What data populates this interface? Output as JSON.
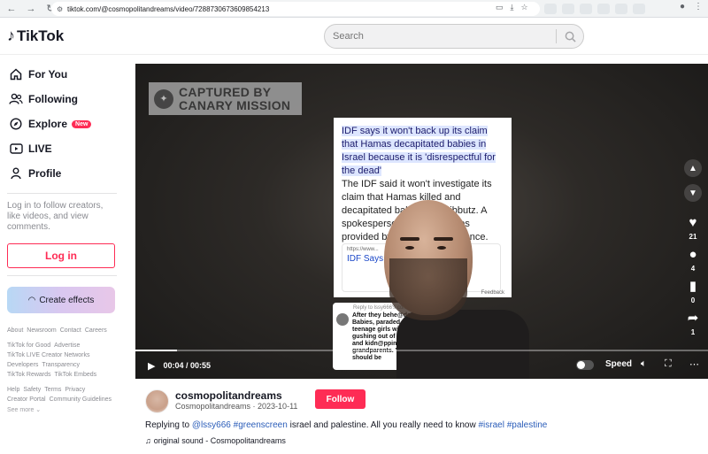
{
  "browser": {
    "url": "tiktok.com/@cosmopolitandreams/video/7288730673609854213"
  },
  "header": {
    "logo": "TikTok",
    "search_placeholder": "Search"
  },
  "sidebar": {
    "items": [
      {
        "label": "For You",
        "icon": "home-icon"
      },
      {
        "label": "Following",
        "icon": "people-icon"
      },
      {
        "label": "Explore",
        "icon": "compass-icon",
        "badge": "New"
      },
      {
        "label": "LIVE",
        "icon": "live-icon"
      },
      {
        "label": "Profile",
        "icon": "person-icon"
      }
    ],
    "login_hint": "Log in to follow creators, like videos, and view comments.",
    "login_label": "Log in",
    "effects_label": "Create effects",
    "links": {
      "row1": [
        "About",
        "Newsroom",
        "Contact",
        "Careers"
      ],
      "row2": [
        "TikTok for Good",
        "Advertise",
        "TikTok LIVE Creator Networks",
        "Developers",
        "Transparency",
        "TikTok Rewards",
        "TikTok Embeds"
      ],
      "row3": [
        "Help",
        "Safety",
        "Terms",
        "Privacy",
        "Creator Portal",
        "Community Guidelines"
      ],
      "see_more": "See more ⌄"
    }
  },
  "video": {
    "watermark_line1": "CAPTURED BY",
    "watermark_line2": "CANARY MISSION",
    "article_headline": "IDF says it won't back up its claim that Hamas decapitated babies in Israel because it is 'disrespectful for the dead'",
    "article_body": "The IDF said it won't investigate its claim that Hamas killed and decapitated babies at a kibbutz. A spokesperson s... testimonies provided by ... sufficient evidence.",
    "link_url": "https://www...",
    "link_title": "IDF Says I... ded Babies, W...",
    "feedback": "Feedback",
    "comment_reply": "Reply to lssy666's comment",
    "comment_text": "After they behe@ded 40 Babies, paraded our teenage girls with blood gushing out of their pants and kidn@pping our grandparents. Yes, they should be",
    "likes": "21",
    "comments": "4",
    "saves": "0",
    "shares": "1",
    "time": "00:04 / 00:55",
    "speed_label": "Speed",
    "progress": 0.073
  },
  "info": {
    "username": "cosmopolitandreams",
    "meta": "Cosmopolitandreams · 2023-10-11",
    "follow_label": "Follow",
    "caption_prefix": "Replying to ",
    "caption_mention": "@lssy666",
    "caption_tag1": "#greenscreen",
    "caption_mid": " israel and palestine. All you really need to know ",
    "caption_tag2": "#israel",
    "caption_tag3": "#palestine",
    "sound": "original sound - Cosmopolitandreams"
  },
  "colors": {
    "brand": "#fe2c55",
    "link": "#2b5db9"
  }
}
